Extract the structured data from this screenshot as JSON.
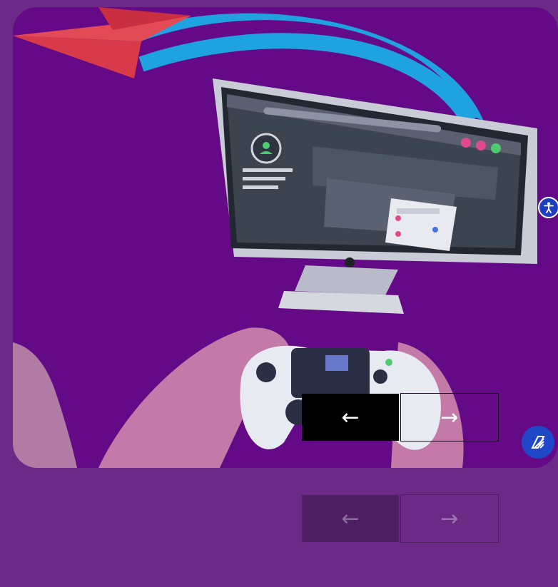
{
  "carousel": {
    "prev_label": "←",
    "next_label": "→",
    "prev_icon": "arrow-left-icon",
    "next_icon": "arrow-right-icon"
  },
  "accessibility": {
    "icon": "accessibility-icon"
  },
  "chat_widget": {
    "icon": "chat-widget-icon"
  },
  "illustration": {
    "subject": "gamer-with-controller-and-computer",
    "colors": {
      "background": "#650a86",
      "page": "#6a2a86",
      "plane": "#d83a4a",
      "arc": "#1ea3e0",
      "hand": "#c47aa8"
    }
  }
}
